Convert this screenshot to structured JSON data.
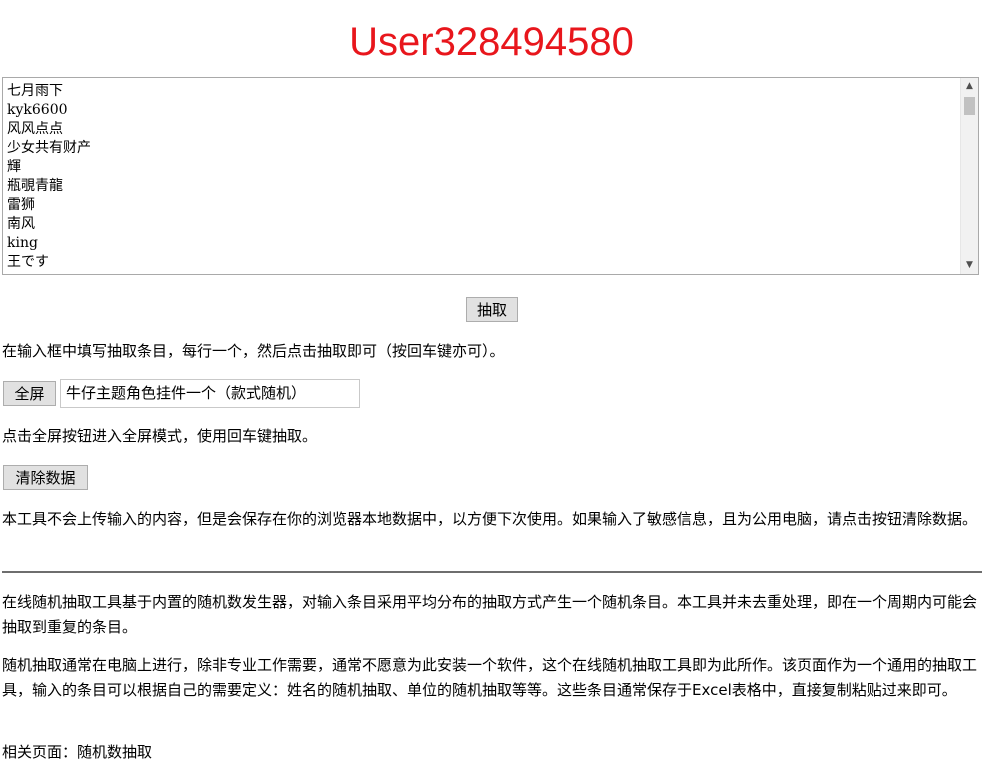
{
  "result": {
    "winner": "User328494580"
  },
  "entries": [
    "七月雨下",
    "kyk6600",
    "风风点点",
    "少女共有财产",
    "輝",
    "瓶覗青龍",
    "雷狮",
    "南风",
    "king",
    "王です"
  ],
  "controls": {
    "draw_label": "抽取",
    "fullscreen_label": "全屏",
    "prize_value": "牛仔主题角色挂件一个（款式随机）",
    "clear_label": "清除数据"
  },
  "help": {
    "instruction": "在输入框中填写抽取条目，每行一个，然后点击抽取即可（按回车键亦可）。",
    "fullscreen_tip": "点击全屏按钮进入全屏模式，使用回车键抽取。",
    "privacy": "本工具不会上传输入的内容，但是会保存在你的浏览器本地数据中，以方便下次使用。如果输入了敏感信息，且为公用电脑，请点击按钮清除数据。"
  },
  "about": {
    "para1": "在线随机抽取工具基于内置的随机数发生器，对输入条目采用平均分布的抽取方式产生一个随机条目。本工具并未去重处理，即在一个周期内可能会抽取到重复的条目。",
    "para2": "随机抽取通常在电脑上进行，除非专业工作需要，通常不愿意为此安装一个软件，这个在线随机抽取工具即为此所作。该页面作为一个通用的抽取工具，输入的条目可以根据自己的需要定义：姓名的随机抽取、单位的随机抽取等等。这些条目通常保存于Excel表格中，直接复制粘贴过来即可。",
    "related_label": "相关页面：",
    "related_link": "随机数抽取"
  },
  "icons": {
    "scroll_up": "▲",
    "scroll_down": "▼"
  },
  "colors": {
    "winner": "#e8161c"
  }
}
